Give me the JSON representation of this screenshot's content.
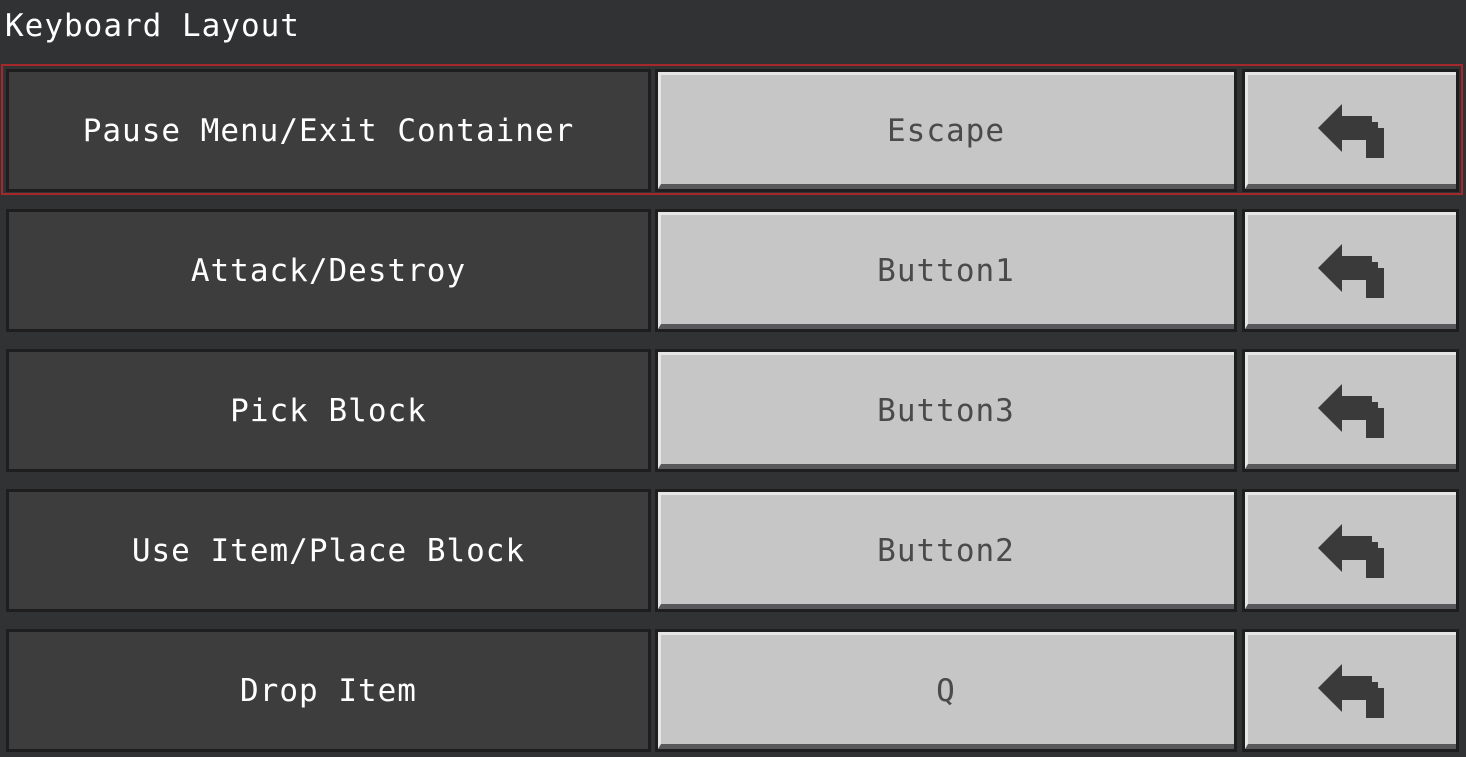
{
  "section": {
    "title": "Keyboard Layout"
  },
  "bindings": [
    {
      "action": "Pause Menu/Exit Container",
      "key": "Escape",
      "selected": true,
      "reset_icon": "undo-arrow-icon"
    },
    {
      "action": "Attack/Destroy",
      "key": "Button1",
      "selected": false,
      "reset_icon": "undo-arrow-icon"
    },
    {
      "action": "Pick Block",
      "key": "Button3",
      "selected": false,
      "reset_icon": "undo-arrow-icon"
    },
    {
      "action": "Use Item/Place Block",
      "key": "Button2",
      "selected": false,
      "reset_icon": "undo-arrow-icon"
    },
    {
      "action": "Drop Item",
      "key": "Q",
      "selected": false,
      "reset_icon": "undo-arrow-icon"
    }
  ],
  "colors": {
    "background": "#313233",
    "selection_border": "#a5282a",
    "label_bg": "#3d3d3e",
    "button_bg": "#c6c6c6",
    "button_text": "#4a4a4a",
    "icon": "#3a3a3a"
  }
}
